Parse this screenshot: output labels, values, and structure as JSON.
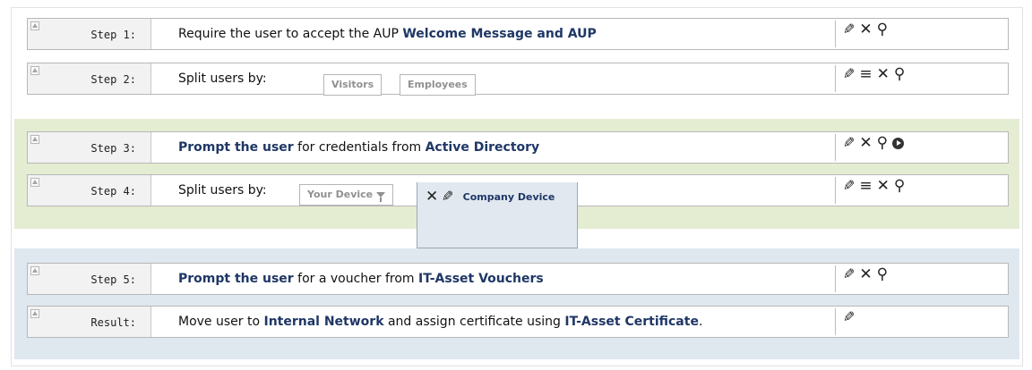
{
  "rows": [
    {
      "step": "Step 1:",
      "desc": [
        {
          "t": "Require the user to accept the AUP ",
          "b": false
        },
        {
          "t": "Welcome Message and AUP",
          "b": true
        }
      ]
    },
    {
      "step": "Step 2:",
      "desc": [
        {
          "t": "Split users by:",
          "b": false
        }
      ],
      "tabs": [
        "Visitors",
        "Employees"
      ]
    },
    {
      "step": "Step 3:",
      "desc": [
        {
          "t": "Prompt the user",
          "b": true
        },
        {
          "t": " for credentials from ",
          "b": false
        },
        {
          "t": "Active Directory",
          "b": true
        }
      ]
    },
    {
      "step": "Step 4:",
      "desc": [
        {
          "t": "Split users by:",
          "b": false
        }
      ],
      "tabs": [
        "Your Device"
      ]
    },
    {
      "step": "Step 5:",
      "desc": [
        {
          "t": "Prompt the user",
          "b": true
        },
        {
          "t": " for a voucher from ",
          "b": false
        },
        {
          "t": "IT-Asset Vouchers",
          "b": true
        }
      ]
    },
    {
      "step": "Result:",
      "desc": [
        {
          "t": "Move user to ",
          "b": false
        },
        {
          "t": "Internal Network",
          "b": true
        },
        {
          "t": " and assign certificate using ",
          "b": false
        },
        {
          "t": "IT-Asset Certificate",
          "b": true
        },
        {
          "t": ".",
          "b": false
        }
      ]
    }
  ],
  "popup": {
    "name": "Company Device"
  },
  "icons": {
    "edit": "pencil-icon",
    "delete": "close-icon",
    "search": "magnifier-icon",
    "reorder": "list-icon",
    "play": "play-icon",
    "filter": "filter-icon"
  },
  "colors": {
    "green_band": "#e4ecd2",
    "blue_band": "#dfe7ef",
    "highlight": "#1f3766"
  }
}
